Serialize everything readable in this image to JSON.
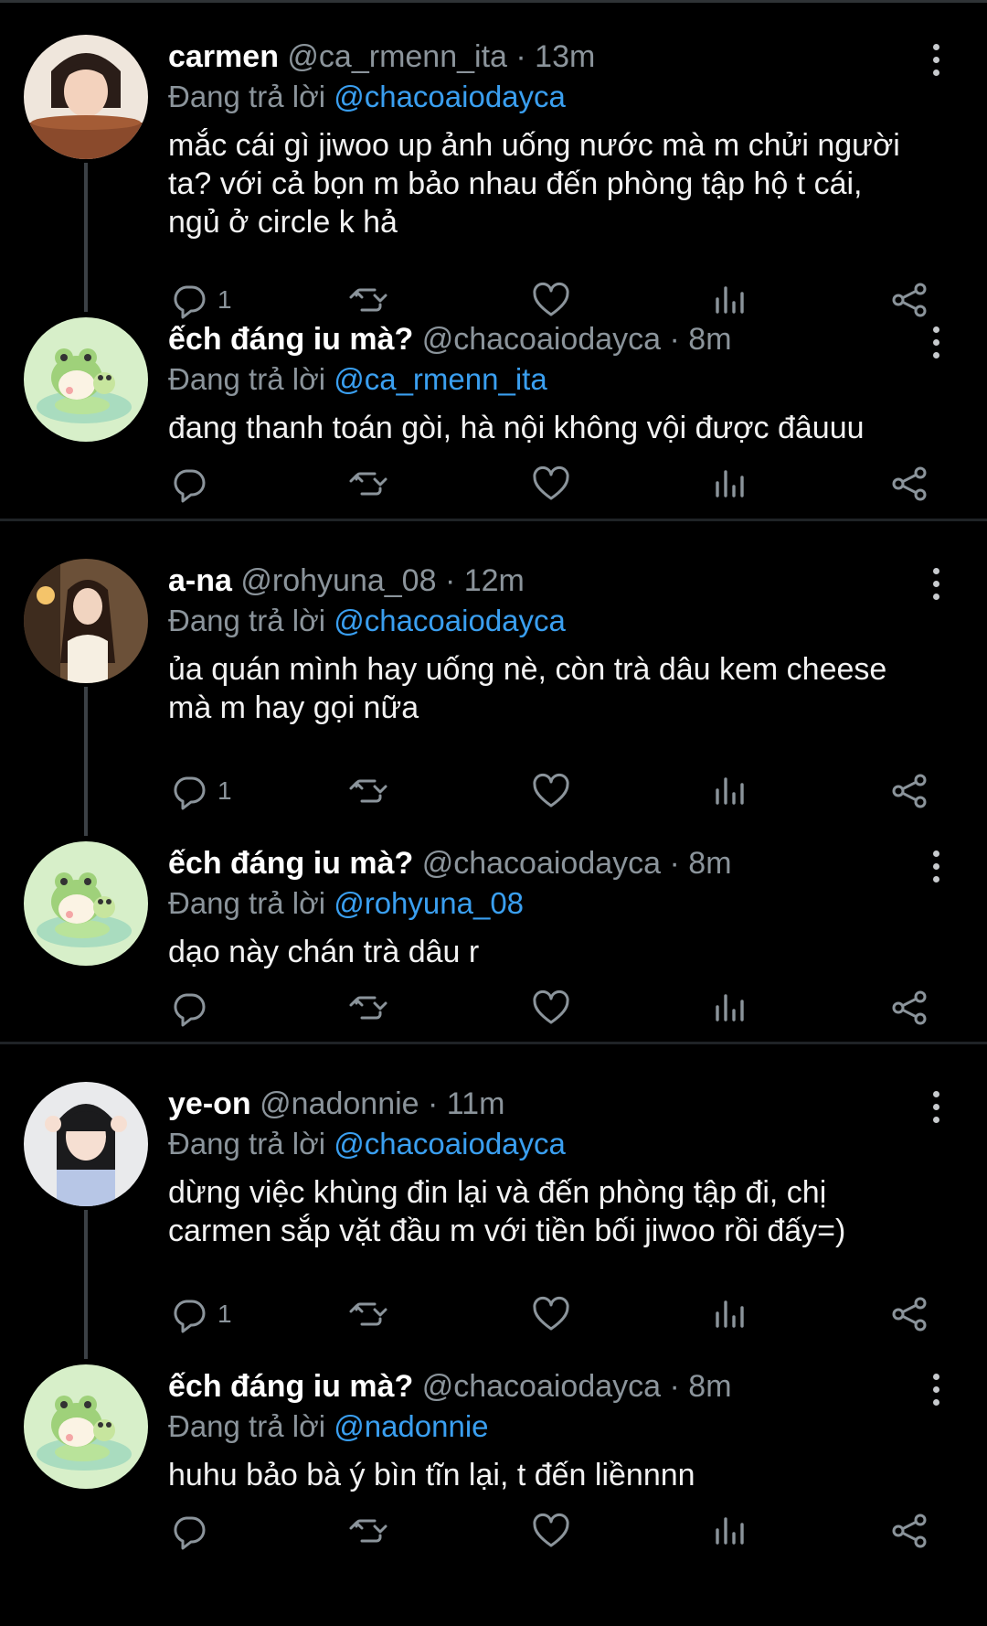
{
  "reply_prefix": "Đang trả lời",
  "threads": [
    {
      "parent": {
        "name": "carmen",
        "handle": "@ca_rmenn_ita",
        "time": "13m",
        "reply_to": "@chacoaiodayca",
        "text_lines": [
          "mắc cái gì jiwoo up ảnh uống nước mà m chửi người",
          "ta? với cả bọn m bảo nhau đến phòng tập hộ t cái,",
          "ngủ ở circle k hả"
        ],
        "reply_count": "1",
        "avatar": "girl-avatar-carmen"
      },
      "reply": {
        "name": "ếch đáng iu mà?",
        "handle": "@chacoaiodayca",
        "time": "8m",
        "reply_to": "@ca_rmenn_ita",
        "text_lines": [
          "đang thanh toán gòi, hà nội không vội được đâuuu"
        ],
        "reply_count": "",
        "avatar": "frog-avatar"
      }
    },
    {
      "parent": {
        "name": "a-na",
        "handle": "@rohyuna_08",
        "time": "12m",
        "reply_to": "@chacoaiodayca",
        "text_lines": [
          "ủa quán mình hay uống nè, còn trà dâu kem cheese",
          "mà m hay gọi nữa"
        ],
        "reply_count": "1",
        "avatar": "girl-avatar-ana"
      },
      "reply": {
        "name": "ếch đáng iu mà?",
        "handle": "@chacoaiodayca",
        "time": "8m",
        "reply_to": "@rohyuna_08",
        "text_lines": [
          "dạo này chán trà dâu r"
        ],
        "reply_count": "",
        "avatar": "frog-avatar"
      }
    },
    {
      "parent": {
        "name": "ye-on",
        "handle": "@nadonnie",
        "time": "11m",
        "reply_to": "@chacoaiodayca",
        "text_lines": [
          "dừng việc khùng đin lại và đến phòng tập đi, chị",
          "carmen sắp vặt đầu m với tiền bối jiwoo rồi đấy=)"
        ],
        "reply_count": "1",
        "avatar": "girl-avatar-yeon"
      },
      "reply": {
        "name": "ếch đáng iu mà?",
        "handle": "@chacoaiodayca",
        "time": "8m",
        "reply_to": "@nadonnie",
        "text_lines": [
          "huhu bảo bà ý bìn tĩn lại, t đến liềnnnn"
        ],
        "reply_count": "",
        "avatar": "frog-avatar"
      }
    }
  ],
  "icons": [
    "reply-icon",
    "retweet-icon",
    "like-icon",
    "views-icon",
    "share-icon",
    "more-icon"
  ],
  "colors": {
    "background": "#000000",
    "mention": "#3a9ff0",
    "muted": "#8b949b",
    "thread_line": "#3b4045"
  }
}
